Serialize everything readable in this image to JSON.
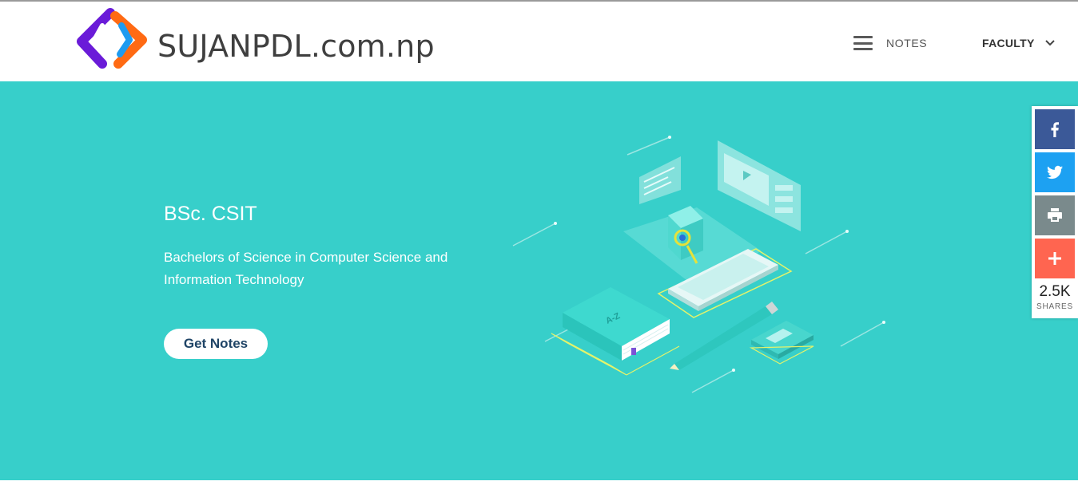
{
  "header": {
    "brand": "SUJANPDL.com.np",
    "nav": {
      "notes_label": "NOTES",
      "faculty_label": "FACULTY"
    }
  },
  "hero": {
    "title": "BSc. CSIT",
    "description": "Bachelors of Science in Computer Science and Information Technology",
    "button_label": "Get Notes",
    "book_label": "A-Z",
    "background_color": "#37cfca"
  },
  "share_bar": {
    "count": "2.5K",
    "label": "SHARES",
    "buttons": [
      {
        "name": "facebook",
        "icon": "facebook-icon",
        "color": "#3b5998"
      },
      {
        "name": "twitter",
        "icon": "twitter-icon",
        "color": "#1da1f2"
      },
      {
        "name": "print",
        "icon": "print-icon",
        "color": "#7a8a8c"
      },
      {
        "name": "more",
        "icon": "plus-icon",
        "color": "#ff6550"
      }
    ]
  }
}
